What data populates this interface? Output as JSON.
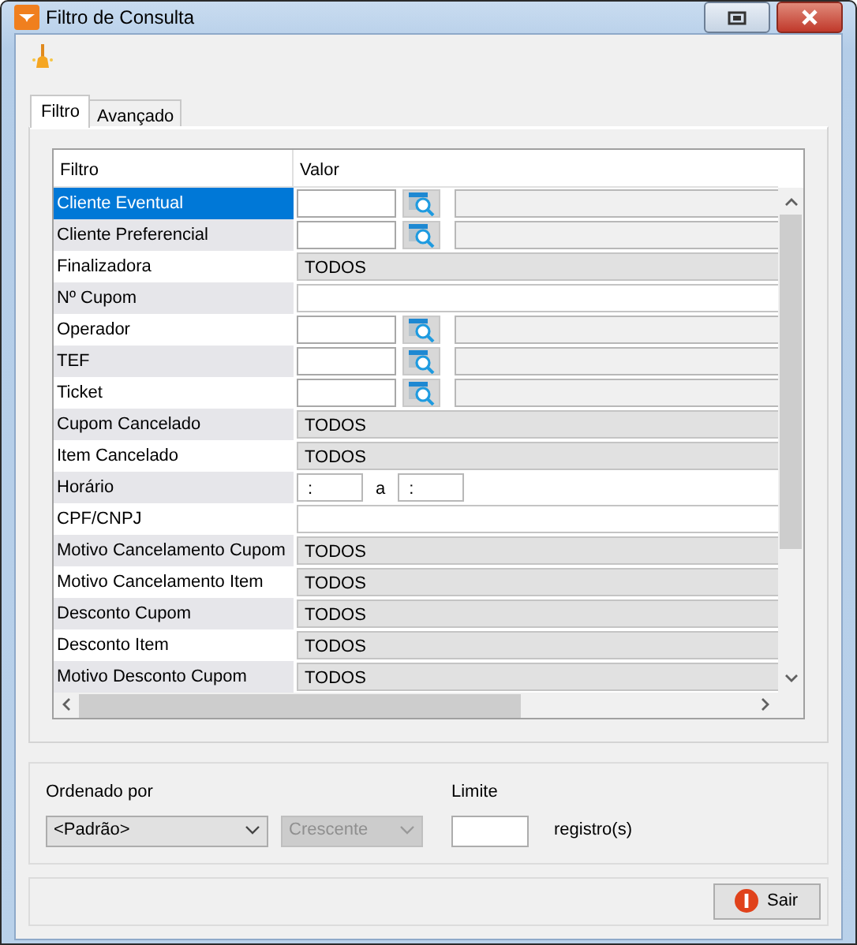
{
  "window": {
    "title": "Filtro de Consulta"
  },
  "tabs": [
    {
      "label": "Filtro",
      "selected": true
    },
    {
      "label": "Avançado",
      "selected": false
    }
  ],
  "grid": {
    "columns": [
      "Filtro",
      "Valor"
    ],
    "rows": [
      {
        "label": "Cliente Eventual",
        "kind": "lookup",
        "selected": true
      },
      {
        "label": "Cliente Preferencial",
        "kind": "lookup",
        "selected": false
      },
      {
        "label": "Finalizadora",
        "kind": "combo",
        "value": "TODOS",
        "selected": false
      },
      {
        "label": "Nº Cupom",
        "kind": "text",
        "selected": false
      },
      {
        "label": "Operador",
        "kind": "lookup",
        "selected": false
      },
      {
        "label": "TEF",
        "kind": "lookup",
        "selected": false
      },
      {
        "label": "Ticket",
        "kind": "lookup",
        "selected": false
      },
      {
        "label": "Cupom Cancelado",
        "kind": "combo",
        "value": "TODOS",
        "selected": false
      },
      {
        "label": "Item Cancelado",
        "kind": "combo",
        "value": "TODOS",
        "selected": false
      },
      {
        "label": "Horário",
        "kind": "time",
        "from": ":",
        "separator": "a",
        "to": ":",
        "selected": false
      },
      {
        "label": "CPF/CNPJ",
        "kind": "text",
        "selected": false
      },
      {
        "label": "Motivo Cancelamento Cupom",
        "kind": "combo",
        "value": "TODOS",
        "selected": false
      },
      {
        "label": "Motivo Cancelamento Item",
        "kind": "combo",
        "value": "TODOS",
        "selected": false
      },
      {
        "label": "Desconto Cupom",
        "kind": "combo",
        "value": "TODOS",
        "selected": false
      },
      {
        "label": "Desconto Item",
        "kind": "combo",
        "value": "TODOS",
        "selected": false
      },
      {
        "label": "Motivo Desconto Cupom",
        "kind": "combo",
        "value": "TODOS",
        "selected": false
      }
    ]
  },
  "order": {
    "label": "Ordenado por",
    "fields": [
      {
        "value": "<Padrão>",
        "disabled": false
      },
      {
        "value": "Crescente",
        "disabled": true
      }
    ]
  },
  "limit": {
    "label": "Limite",
    "unit": "registro(s)"
  },
  "buttons": [
    {
      "label": "Sair"
    }
  ]
}
